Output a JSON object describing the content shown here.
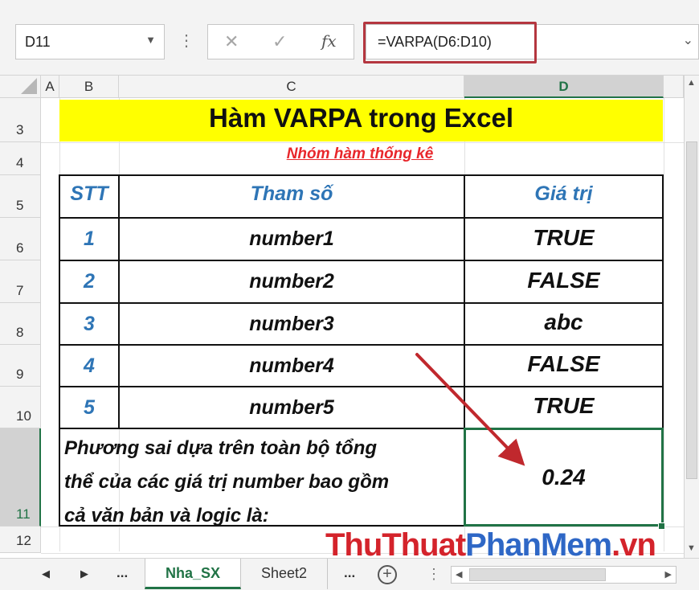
{
  "formula_bar": {
    "name_box": "D11",
    "name_box_arrow": "▼",
    "dots": "⋮",
    "cancel": "✕",
    "enter": "✓",
    "fx": "fx",
    "formula": "=VARPA(D6:D10)",
    "expand": "⌄"
  },
  "columns": [
    "A",
    "B",
    "C",
    "D"
  ],
  "rows": [
    "3",
    "4",
    "5",
    "6",
    "7",
    "8",
    "9",
    "10",
    "11",
    "12"
  ],
  "sheet": {
    "title": "Hàm VARPA trong Excel",
    "subtitle": "Nhóm hàm thống kê",
    "headers": {
      "stt": "STT",
      "param": "Tham số",
      "value": "Giá trị"
    },
    "table_rows": [
      {
        "stt": "1",
        "param": "number1",
        "value": "TRUE"
      },
      {
        "stt": "2",
        "param": "number2",
        "value": "FALSE"
      },
      {
        "stt": "3",
        "param": "number3",
        "value": "abc"
      },
      {
        "stt": "4",
        "param": "number4",
        "value": "FALSE"
      },
      {
        "stt": "5",
        "param": "number5",
        "value": "TRUE"
      }
    ],
    "summary_lines": [
      "Phương sai dựa trên toàn bộ tổng",
      "thể của các giá trị number bao gồm",
      "cả văn bản và logic là:"
    ],
    "result": "0.24"
  },
  "watermark": {
    "part1": "ThuThuat",
    "part2": "PhanMem",
    "part3": ".vn"
  },
  "tabs": {
    "prev": "◀",
    "next": "▶",
    "ellipsis": "...",
    "items": [
      "Nha_SX",
      "Sheet2"
    ],
    "active": "Nha_SX",
    "add": "+"
  },
  "colors": {
    "accent": "#217346",
    "title_fill": "#ffff00",
    "header_text": "#2e75b6",
    "subtitle": "#e8262b",
    "arrow": "#c0282d"
  }
}
